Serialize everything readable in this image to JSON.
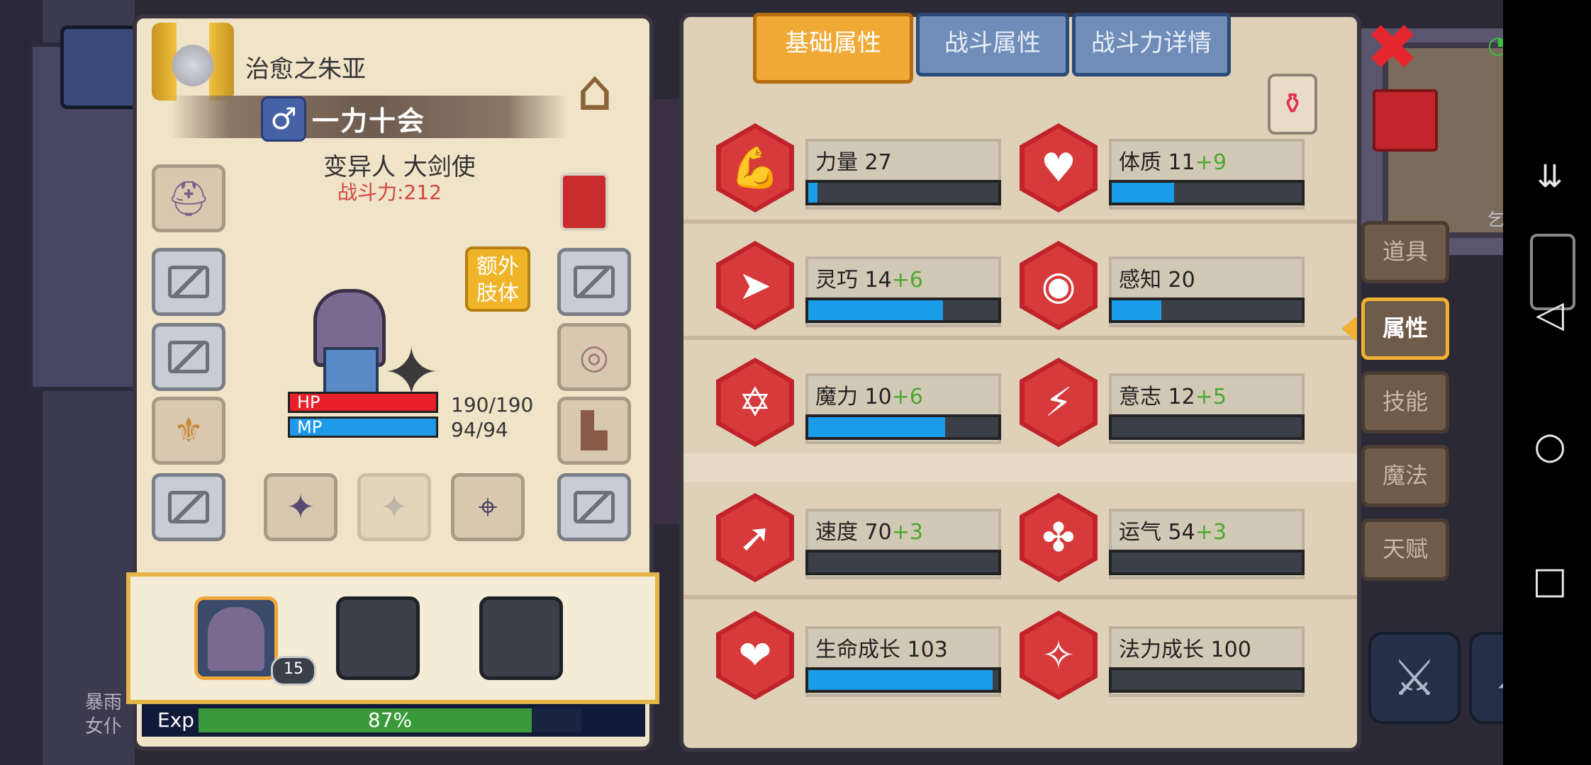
{
  "character": {
    "name": "治愈之朱亚",
    "gender_symbol": "♂",
    "player_name": "一力十会",
    "race_class": "变异人 大剑使",
    "combat_power": "战斗力:212",
    "extra_limb": "额外肢体",
    "hp_label": "HP",
    "hp_value": "190/190",
    "mp_label": "MP",
    "mp_value": "94/94",
    "level": "15"
  },
  "exp": {
    "label": "Exp",
    "percent_text": "87%",
    "percent": 0.87
  },
  "tabs": [
    "基础属性",
    "战斗属性",
    "战斗力详情"
  ],
  "active_tab": 0,
  "stats": [
    {
      "name": "力量",
      "value": "27",
      "bonus": "",
      "fill": 0.05,
      "icon": "muscle-icon"
    },
    {
      "name": "体质",
      "value": "11",
      "bonus": "+9",
      "fill": 0.33,
      "icon": "body-icon"
    },
    {
      "name": "灵巧",
      "value": "14",
      "bonus": "+6",
      "fill": 0.71,
      "icon": "runner-icon"
    },
    {
      "name": "感知",
      "value": "20",
      "bonus": "",
      "fill": 0.26,
      "icon": "eye-icon"
    },
    {
      "name": "魔力",
      "value": "10",
      "bonus": "+6",
      "fill": 0.72,
      "icon": "hexagram-icon"
    },
    {
      "name": "意志",
      "value": "12",
      "bonus": "+5",
      "fill": 0.0,
      "icon": "mind-icon"
    },
    {
      "name": "速度",
      "value": "70",
      "bonus": "+3",
      "fill": 0.0,
      "icon": "speed-icon"
    },
    {
      "name": "运气",
      "value": "54",
      "bonus": "+3",
      "fill": 0.0,
      "icon": "clover-icon"
    },
    {
      "name": "生命成长",
      "value": "103",
      "bonus": "",
      "fill": 0.97,
      "icon": "heart-growth-icon"
    },
    {
      "name": "法力成长",
      "value": "100",
      "bonus": "",
      "fill": 0.0,
      "icon": "mana-growth-icon"
    }
  ],
  "side_tabs": [
    "道具",
    "属性",
    "技能",
    "魔法",
    "天赋"
  ],
  "active_side_tab": 1,
  "close_symbol": "✖",
  "background": {
    "location": "乞丐洞窟",
    "npc_line1": "暴雨",
    "npc_line2": "女仆"
  },
  "colors": {
    "accent_tab": "#f0a935",
    "bar_fill": "#1a9ce8",
    "bonus": "#4ca830",
    "power": "#d4453f"
  }
}
